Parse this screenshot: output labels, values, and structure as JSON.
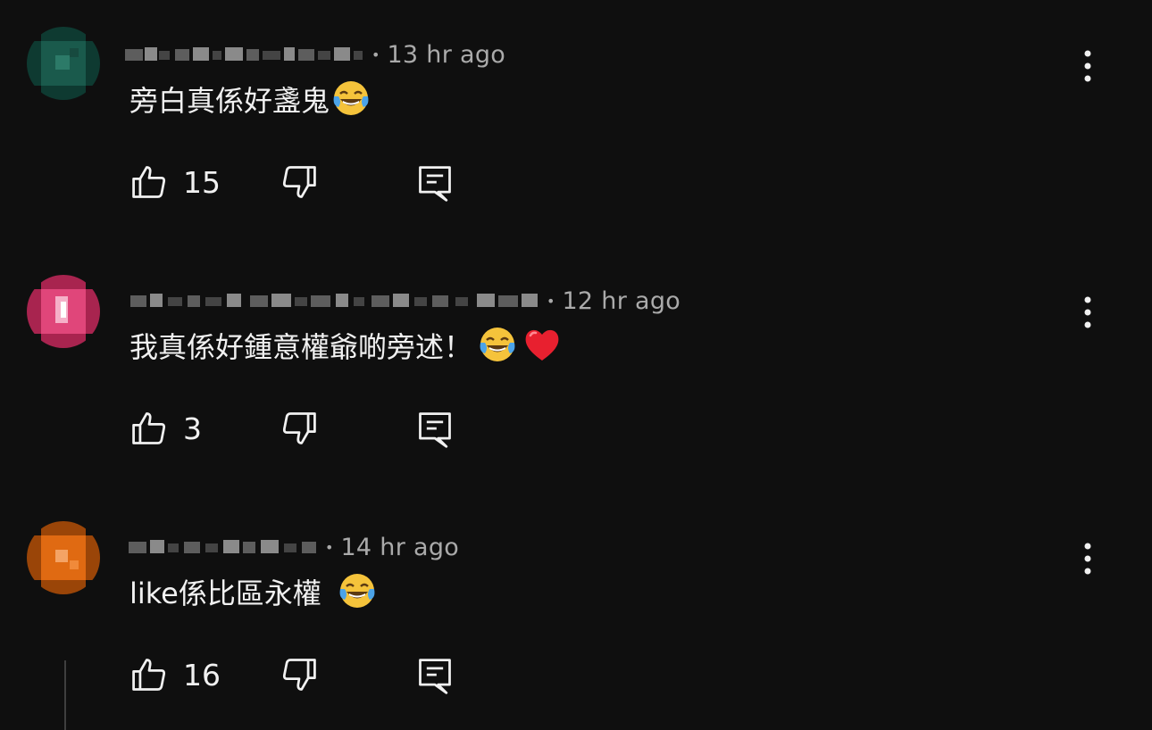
{
  "comments": [
    {
      "time": "13 hr ago",
      "text": "旁白真係好盞鬼",
      "emojis": [
        "face-with-tears-of-joy"
      ],
      "likes": "15",
      "avatar_color": "#1a5a4c"
    },
    {
      "time": "12 hr ago",
      "text": "我真係好鍾意權爺啲旁述！",
      "emojis": [
        "face-with-tears-of-joy",
        "red-heart"
      ],
      "likes": "3",
      "avatar_color": "#e0467a"
    },
    {
      "time": "14 hr ago",
      "text": "like係比區永權 ",
      "emojis": [
        "face-with-tears-of-joy"
      ],
      "likes": "16",
      "avatar_color": "#e06a12"
    }
  ],
  "separator": "•",
  "colors": {
    "background": "#0f0f0f",
    "text": "#f1f1f1",
    "secondary_text": "#aaaaaa"
  }
}
